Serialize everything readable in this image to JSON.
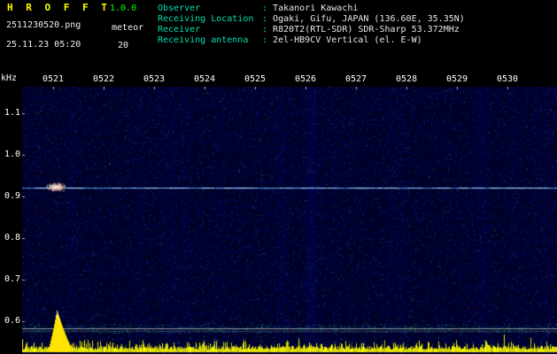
{
  "header": {
    "app_title": "H R O F F T",
    "version": "1.0.0",
    "filename": "2511230520.png",
    "mode_label": "meteor",
    "datetime": "25.11.23 05:20",
    "count": "20",
    "info_rows": [
      {
        "label": "Observer",
        "value": "Takanori Kawachi"
      },
      {
        "label": "Receiving Location",
        "value": "Ogaki, Gifu, JAPAN (136.60E, 35.35N)"
      },
      {
        "label": "Receiver",
        "value": "R820T2(RTL-SDR) SDR-Sharp 53.372MHz"
      },
      {
        "label": "Receiving antenna",
        "value": "2el-HB9CV Vertical (el. E-W)"
      }
    ]
  },
  "chart_data": {
    "type": "heatmap",
    "description": "HROFFT radio-meteor spectrogram (waterfall) for 05:20-05:30 with signal-strength bar trace along the bottom",
    "x_axis": "time (HHMM, UT+9)",
    "x_tick_labels": [
      "0521",
      "0522",
      "0523",
      "0524",
      "0525",
      "0526",
      "0527",
      "0528",
      "0529",
      "0530"
    ],
    "y_unit_label": "kHz",
    "y_tick_labels": [
      "1.1",
      "1.0",
      "0.9",
      "0.8",
      "0.7",
      "0.6"
    ],
    "y_range_khz": [
      0.56,
      1.17
    ],
    "carrier_line_khz": 0.92,
    "grid": "off",
    "events": [
      {
        "time": "0521",
        "freq_khz": 0.92,
        "type": "meteor-echo",
        "note": "bright reddish echo on carrier line with large yellow signal-strength spike below"
      }
    ],
    "colors": {
      "background": "#000000",
      "noise_base": "#000026",
      "carrier_line": "#6ec8ff",
      "strength_bars": "#ffff00",
      "separator_line": "#9a9a9a",
      "axis_text": "#ffffff",
      "label_text": "#00dfae",
      "title_text": "#ffff00",
      "version_text": "#00ff00"
    }
  }
}
